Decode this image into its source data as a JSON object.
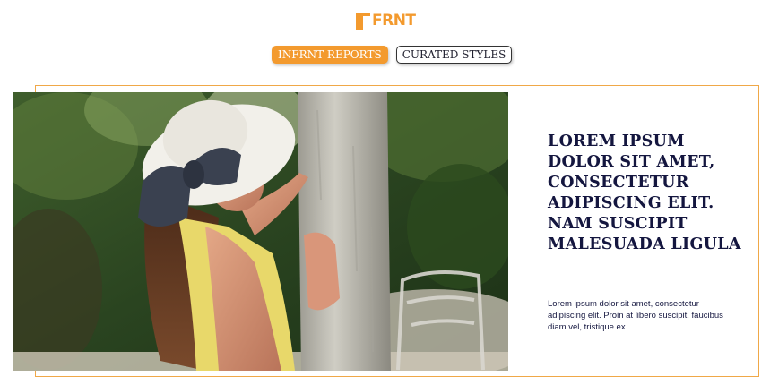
{
  "header": {
    "logo_text": "FRNT",
    "logo_letter": "IN",
    "brand_color": "#f39a2e"
  },
  "nav": {
    "items": [
      {
        "label": "INFRNT REPORTS",
        "active": true
      },
      {
        "label": "CURATED STYLES",
        "active": false
      }
    ]
  },
  "feature": {
    "headline": "LOREM IPSUM DOLOR SIT AMET, CONSECTETUR ADIPISCING ELIT. NAM SUSCIPIT MALESUADA LIGULA",
    "body": "Lorem ipsum dolor sit amet, consectetur adipiscing elit.  Proin at libero suscipit, faucibus diam vel, tristique ex.",
    "text_color": "#14163f",
    "frame_color": "#f0a848"
  }
}
